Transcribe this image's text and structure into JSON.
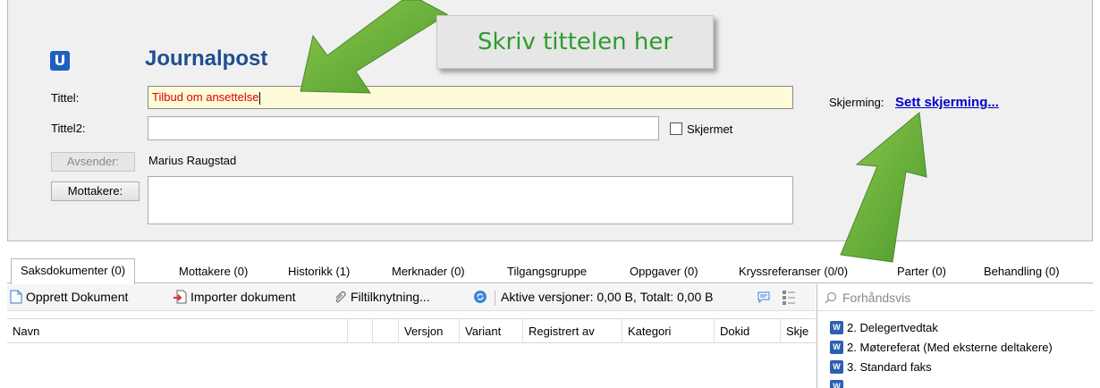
{
  "header": {
    "title": "Journalpost",
    "logo_letter": "U"
  },
  "form": {
    "tittel_label": "Tittel:",
    "tittel_value": "Tilbud om ansettelse",
    "tittel2_label": "Tittel2:",
    "tittel2_value": "",
    "skjermet_label": "Skjermet",
    "avsender_label": "Avsender:",
    "avsender_value": "Marius Raugstad",
    "mottakere_label": "Mottakere:",
    "skjerming_label": "Skjerming:",
    "skjerming_link": "Sett skjerming..."
  },
  "callout": {
    "text": "Skriv tittelen her",
    "color": "#2e9c2e"
  },
  "tabs": [
    {
      "label": "Saksdokumenter (0)",
      "active": true
    },
    {
      "label": "Mottakere (0)"
    },
    {
      "label": "Historikk (1)"
    },
    {
      "label": "Merknader (0)"
    },
    {
      "label": "Tilgangsgruppe"
    },
    {
      "label": "Oppgaver (0)"
    },
    {
      "label": "Kryssreferanser (0/0)"
    },
    {
      "label": "Parter (0)"
    },
    {
      "label": "Behandling (0)"
    }
  ],
  "toolbar": {
    "create_document": "Opprett Dokument",
    "import_document": "Importer dokument",
    "file_link": "Filtilknytning...",
    "active_versions": "Aktive versjoner: 0,00 B,",
    "total": "Totalt: 0,00 B"
  },
  "grid": {
    "columns": [
      "Navn",
      "",
      "",
      "Versjon",
      "Variant",
      "Registrert av",
      "Kategori",
      "Dokid",
      "Skje"
    ]
  },
  "preview": {
    "search_placeholder": "Forhåndsvis",
    "documents": [
      "2. Delegertvedtak",
      "2. Møtereferat (Med eksterne deltakere)",
      "3. Standard faks"
    ]
  },
  "colors": {
    "accent": "#1f4e8f",
    "title_text": "#e00000",
    "title_field_bg": "#fdfbd8",
    "link": "#0000cc",
    "annotation_arrow": "#5aa83a"
  }
}
